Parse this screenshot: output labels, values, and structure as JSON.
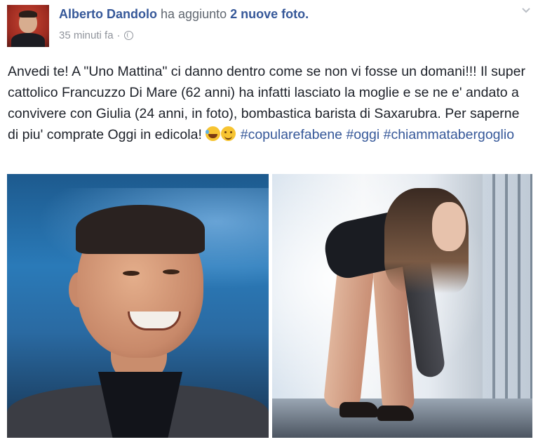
{
  "post": {
    "author": "Alberto Dandolo",
    "action": "ha aggiunto",
    "photos_link": "2 nuove foto.",
    "time": "35 minuti fa",
    "separator": "·",
    "text_main": "Anvedi te! A \"Uno Mattina\" ci danno dentro come se non vi fosse un domani!!! Il super cattolico Francuzzo Di Mare (62 anni) ha infatti lasciato la moglie e se ne e' andato a convivere con Giulia (24 anni, in foto), bombastica barista di Saxarubra. Per saperne di piu' comprate Oggi in edicola!",
    "emojis": [
      "laughing-tears-emoji",
      "wink-emoji"
    ],
    "hashtags": [
      "#copularefabene",
      "#oggi",
      "#chiammatabergoglio"
    ],
    "photos": [
      {
        "icon": "photo-man-smiling"
      },
      {
        "icon": "photo-woman-posing"
      }
    ]
  },
  "colors": {
    "link": "#365899",
    "text": "#1d2129",
    "meta": "#90949c"
  }
}
